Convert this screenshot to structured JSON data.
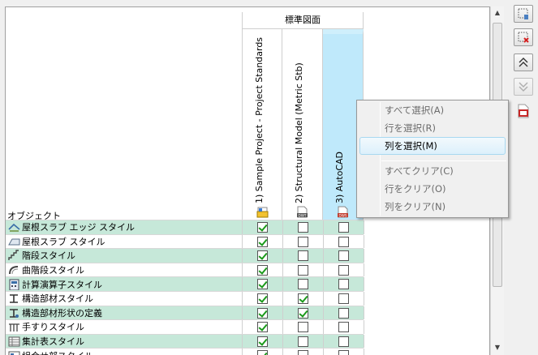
{
  "grid": {
    "object_header": "オブジェクト",
    "group_header": "標準図面",
    "columns": [
      {
        "label": "1) Sample Project - Project Standards",
        "icon": "project-file-icon"
      },
      {
        "label": "2) Structural Model (Metric Stb)",
        "icon": "dwt-file-icon"
      },
      {
        "label": "3) AutoCAD",
        "icon": "dws-file-icon",
        "selected": true
      }
    ],
    "icon_badges": {
      "dwt": "DWT",
      "dws": "DWS"
    },
    "rows": [
      {
        "label": "屋根スラブ エッジ スタイル",
        "icon": "roof-slab-edge-icon",
        "checks": [
          true,
          false,
          false
        ]
      },
      {
        "label": "屋根スラブ スタイル",
        "icon": "roof-slab-icon",
        "checks": [
          true,
          false,
          false
        ]
      },
      {
        "label": "階段スタイル",
        "icon": "stair-icon",
        "checks": [
          true,
          false,
          false
        ]
      },
      {
        "label": "曲階段スタイル",
        "icon": "curved-stair-icon",
        "checks": [
          true,
          false,
          false
        ]
      },
      {
        "label": "計算演算子スタイル",
        "icon": "calculator-icon",
        "checks": [
          true,
          false,
          false
        ]
      },
      {
        "label": "構造部材スタイル",
        "icon": "structural-member-icon",
        "checks": [
          true,
          true,
          false
        ]
      },
      {
        "label": "構造部材形状の定義",
        "icon": "member-shape-icon",
        "checks": [
          true,
          true,
          false
        ]
      },
      {
        "label": "手すりスタイル",
        "icon": "railing-icon",
        "checks": [
          true,
          false,
          false
        ]
      },
      {
        "label": "集計表スタイル",
        "icon": "schedule-table-icon",
        "checks": [
          true,
          false,
          false
        ]
      },
      {
        "label": "組合せ部スタイル",
        "icon": "assembly-icon",
        "checks": [
          true,
          false,
          false
        ]
      }
    ]
  },
  "context_menu": {
    "items": [
      {
        "label": "すべて選択(A)",
        "enabled": false
      },
      {
        "label": "行を選択(R)",
        "enabled": false
      },
      {
        "label": "列を選択(M)",
        "enabled": true,
        "highlighted": true
      },
      {
        "label": "すべてクリア(C)",
        "enabled": false
      },
      {
        "label": "行をクリア(O)",
        "enabled": false
      },
      {
        "label": "列をクリア(N)",
        "enabled": false
      }
    ]
  },
  "side_buttons": [
    {
      "name": "add-file-button",
      "icon": "add-file-icon",
      "enabled": true
    },
    {
      "name": "remove-file-button",
      "icon": "remove-file-icon",
      "enabled": true
    },
    {
      "name": "move-up-button",
      "icon": "chevron-double-up-icon",
      "enabled": true
    },
    {
      "name": "move-down-button",
      "icon": "chevron-double-down-icon",
      "enabled": false
    },
    {
      "name": "pdf-report-button",
      "icon": "pdf-icon",
      "enabled": true
    }
  ],
  "colors": {
    "row_alt": "#c6e8d9",
    "selected_column": "#bfe9fb",
    "check": "#1a9a1a"
  }
}
